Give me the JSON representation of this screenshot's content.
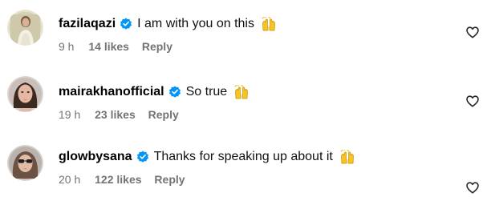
{
  "comments": [
    {
      "username": "fazilaqazi",
      "text": "I am with you on this",
      "emoji": "raising-hands-icon",
      "time": "9 h",
      "likes": "14 likes",
      "reply": "Reply",
      "avatar": "avatar-fazilaqazi"
    },
    {
      "username": "mairakhanofficial",
      "text": "So true",
      "emoji": "raising-hands-icon",
      "time": "19 h",
      "likes": "23 likes",
      "reply": "Reply",
      "avatar": "avatar-mairakhanofficial"
    },
    {
      "username": "glowbysana",
      "text": "Thanks for speaking up about it",
      "emoji": "raising-hands-icon",
      "time": "20 h",
      "likes": "122 likes",
      "reply": "Reply",
      "avatar": "avatar-glowbysana"
    }
  ],
  "colors": {
    "verified_blue": "#0095f6",
    "meta_gray": "#737373",
    "avatar_ring": "#e6e6e6"
  }
}
